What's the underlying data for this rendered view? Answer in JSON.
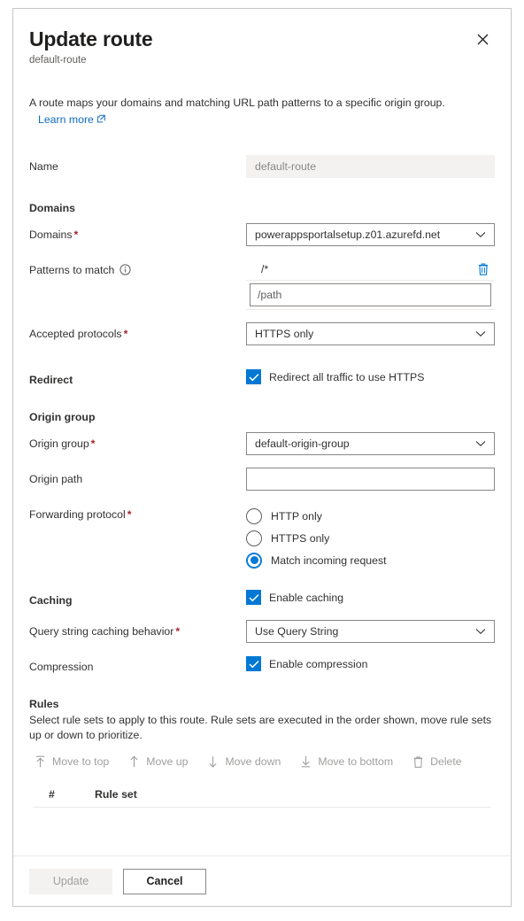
{
  "panel": {
    "title": "Update route",
    "subtitle": "default-route",
    "close_icon": "close-icon",
    "description": "A route maps your domains and matching URL path patterns to a specific origin group.",
    "learn_more": "Learn more",
    "learn_more_icon": "external-link-icon"
  },
  "fields": {
    "name_label": "Name",
    "name_value": "default-route"
  },
  "domains_section": {
    "heading": "Domains",
    "domains_label": "Domains",
    "domains_required": "*",
    "domains_value": "powerappsportalsetup.z01.azurefd.net",
    "patterns_label": "Patterns to match",
    "patterns_info_icon": "info-icon",
    "patterns": [
      {
        "value": "/*",
        "delete_icon": "delete-icon"
      }
    ],
    "pattern_input_placeholder": "/path",
    "pattern_input_value": "",
    "protocols_label": "Accepted protocols",
    "protocols_required": "*",
    "protocols_value": "HTTPS only"
  },
  "redirect_section": {
    "heading": "Redirect",
    "checkbox_label": "Redirect all traffic to use HTTPS",
    "checked": true
  },
  "origin_section": {
    "heading": "Origin group",
    "origin_group_label": "Origin group",
    "origin_group_required": "*",
    "origin_group_value": "default-origin-group",
    "origin_path_label": "Origin path",
    "origin_path_value": "",
    "forwarding_label": "Forwarding protocol",
    "forwarding_required": "*",
    "forwarding_options": [
      {
        "label": "HTTP only",
        "selected": false
      },
      {
        "label": "HTTPS only",
        "selected": false
      },
      {
        "label": "Match incoming request",
        "selected": true
      }
    ]
  },
  "caching_section": {
    "heading": "Caching",
    "enable_caching_label": "Enable caching",
    "enable_caching_checked": true,
    "query_string_label": "Query string caching behavior",
    "query_string_required": "*",
    "query_string_value": "Use Query String",
    "compression_label": "Compression",
    "enable_compression_label": "Enable compression",
    "enable_compression_checked": true
  },
  "rules_section": {
    "heading": "Rules",
    "description": "Select rule sets to apply to this route. Rule sets are executed in the order shown, move rule sets up or down to prioritize.",
    "commands": [
      {
        "label": "Move to top",
        "icon": "move-to-top-icon",
        "disabled": true
      },
      {
        "label": "Move up",
        "icon": "move-up-icon",
        "disabled": true
      },
      {
        "label": "Move down",
        "icon": "move-down-icon",
        "disabled": true
      },
      {
        "label": "Move to bottom",
        "icon": "move-to-bottom-icon",
        "disabled": true
      },
      {
        "label": "Delete",
        "icon": "delete-icon",
        "disabled": true
      }
    ],
    "table_headers": {
      "index": "#",
      "rule_set": "Rule set"
    },
    "rows": []
  },
  "footer": {
    "update_label": "Update",
    "update_disabled": true,
    "cancel_label": "Cancel"
  },
  "colors": {
    "accent": "#0078d4",
    "link": "#0f6cbd",
    "required": "#a4262c",
    "disabled_text": "#a19f9d",
    "border": "#8a8886"
  }
}
